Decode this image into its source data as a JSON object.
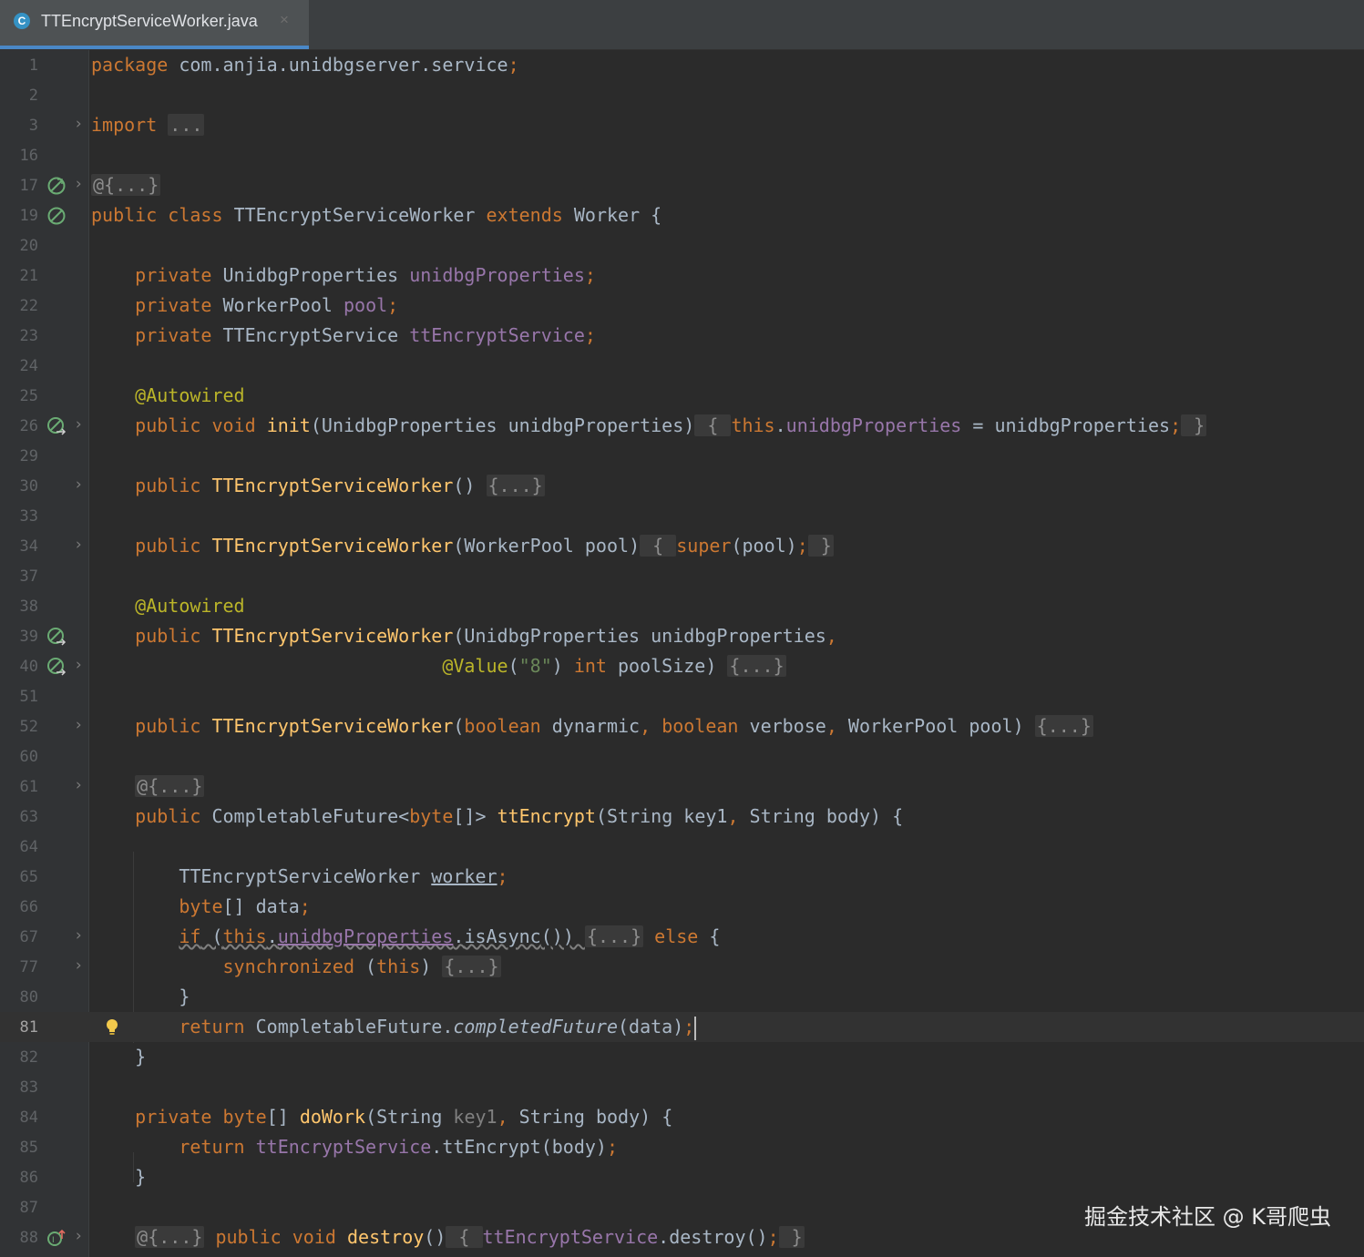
{
  "tab": {
    "title": "TTEncryptServiceWorker.java",
    "icon": "C",
    "close": "×"
  },
  "lines": [
    {
      "n": "1"
    },
    {
      "n": "2"
    },
    {
      "n": "3"
    },
    {
      "n": "16"
    },
    {
      "n": "17"
    },
    {
      "n": "19"
    },
    {
      "n": "20"
    },
    {
      "n": "21"
    },
    {
      "n": "22"
    },
    {
      "n": "23"
    },
    {
      "n": "24"
    },
    {
      "n": "25"
    },
    {
      "n": "26"
    },
    {
      "n": "29"
    },
    {
      "n": "30"
    },
    {
      "n": "33"
    },
    {
      "n": "34"
    },
    {
      "n": "37"
    },
    {
      "n": "38"
    },
    {
      "n": "39"
    },
    {
      "n": "40"
    },
    {
      "n": "51"
    },
    {
      "n": "52"
    },
    {
      "n": "60"
    },
    {
      "n": "61"
    },
    {
      "n": "63"
    },
    {
      "n": "64"
    },
    {
      "n": "65"
    },
    {
      "n": "66"
    },
    {
      "n": "67"
    },
    {
      "n": "77"
    },
    {
      "n": "80"
    },
    {
      "n": "81"
    },
    {
      "n": "82"
    },
    {
      "n": "83"
    },
    {
      "n": "84"
    },
    {
      "n": "85"
    },
    {
      "n": "86"
    },
    {
      "n": "87"
    },
    {
      "n": "88"
    }
  ],
  "t": {
    "package": "package",
    "pkg_name": " com.anjia.unidbgserver.service",
    "semi": ";",
    "import": "import",
    "folded_dots": "...",
    "folded_ann": "@{...}",
    "folded_block": "{...}",
    "public": "public",
    "class": "class",
    "private": "private",
    "void": "void",
    "extends": "extends",
    "return": "return",
    "this": "this",
    "super": "super",
    "int": "int",
    "boolean": "boolean",
    "byte": "byte",
    "if": "if",
    "else": "else",
    "synchronized": "synchronized",
    "class_name": "TTEncryptServiceWorker",
    "worker": "Worker",
    "UnidbgProperties": "UnidbgProperties",
    "WorkerPool": "WorkerPool",
    "TTEncryptService": "TTEncryptService",
    "unidbgProperties": "unidbgProperties",
    "pool": "pool",
    "ttEncryptService": "ttEncryptService",
    "autowired": "@Autowired",
    "value_ann": "@Value",
    "value_str": "\"8\"",
    "init": "init",
    "poolSize": "poolSize",
    "dynarmic": "dynarmic",
    "verbose": "verbose",
    "CompletableFuture": "CompletableFuture",
    "ttEncrypt": "ttEncrypt",
    "String": "String",
    "key1": "key1",
    "body": "body",
    "worker_var": "worker",
    "data": "data",
    "isAsync": "isAsync",
    "completedFuture": "completedFuture",
    "doWork": "doWork",
    "destroy": "destroy"
  },
  "watermark": "掘金技术社区 @ K哥爬虫"
}
